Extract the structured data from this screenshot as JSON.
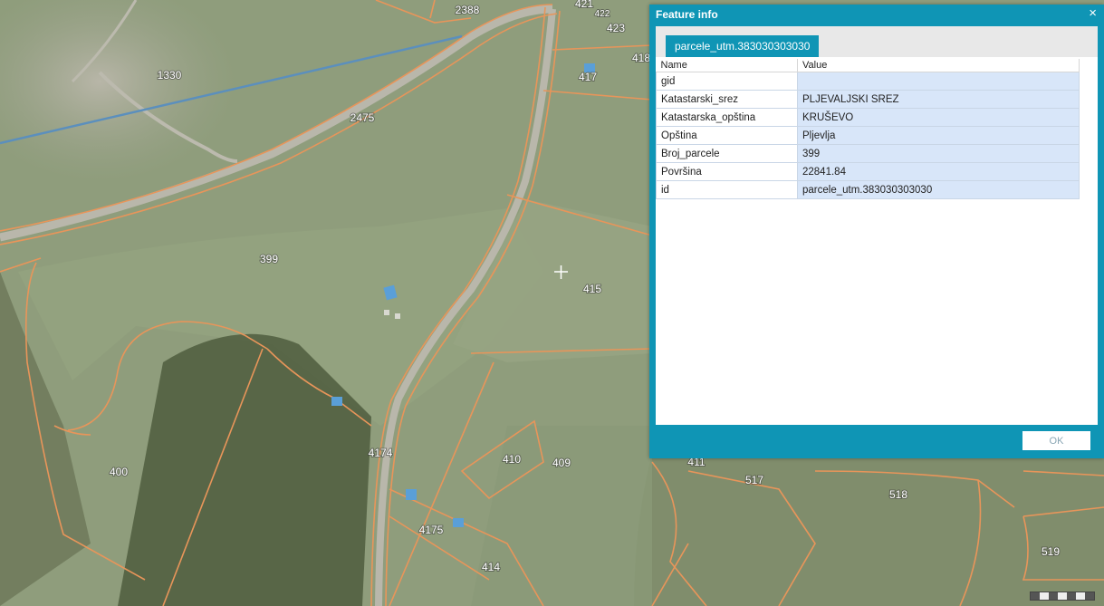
{
  "map": {
    "parcel_labels": [
      {
        "id": "p2388",
        "text": "2388"
      },
      {
        "id": "p421",
        "text": "421"
      },
      {
        "id": "p422",
        "text": "422"
      },
      {
        "id": "p423",
        "text": "423"
      },
      {
        "id": "p418",
        "text": "418"
      },
      {
        "id": "p417",
        "text": "417"
      },
      {
        "id": "p1330",
        "text": "1330"
      },
      {
        "id": "p2475",
        "text": "2475"
      },
      {
        "id": "p399",
        "text": "399"
      },
      {
        "id": "p415",
        "text": "415"
      },
      {
        "id": "p400",
        "text": "400"
      },
      {
        "id": "p4174",
        "text": "4174"
      },
      {
        "id": "p410",
        "text": "410"
      },
      {
        "id": "p409",
        "text": "409"
      },
      {
        "id": "p411",
        "text": "411"
      },
      {
        "id": "p517",
        "text": "517"
      },
      {
        "id": "p518",
        "text": "518"
      },
      {
        "id": "p519",
        "text": "519"
      },
      {
        "id": "p4175",
        "text": "4175"
      },
      {
        "id": "p414",
        "text": "414"
      }
    ],
    "colors": {
      "imagery_base": "#8f9d7c",
      "parcel_boundary": "#e8955a",
      "measure_line": "#5b8fbd",
      "road": "#b9b7ab"
    }
  },
  "feature_info": {
    "title": "Feature info",
    "close_glyph": "×",
    "tab_label": "parcele_utm.383030303030",
    "table": {
      "headers": [
        "Name",
        "Value"
      ],
      "rows": [
        {
          "name": "gid",
          "value": ""
        },
        {
          "name": "Katastarski_srez",
          "value": "PLJEVALJSKI SREZ"
        },
        {
          "name": "Katastarska_opština",
          "value": "KRUŠEVO"
        },
        {
          "name": "Opština",
          "value": "Pljevlja"
        },
        {
          "name": "Broj_parcele",
          "value": "399"
        },
        {
          "name": "Površina",
          "value": "22841.84"
        },
        {
          "name": "id",
          "value": "parcele_utm.383030303030"
        }
      ]
    },
    "ok_label": "OK",
    "accent": "#0f95b5"
  }
}
